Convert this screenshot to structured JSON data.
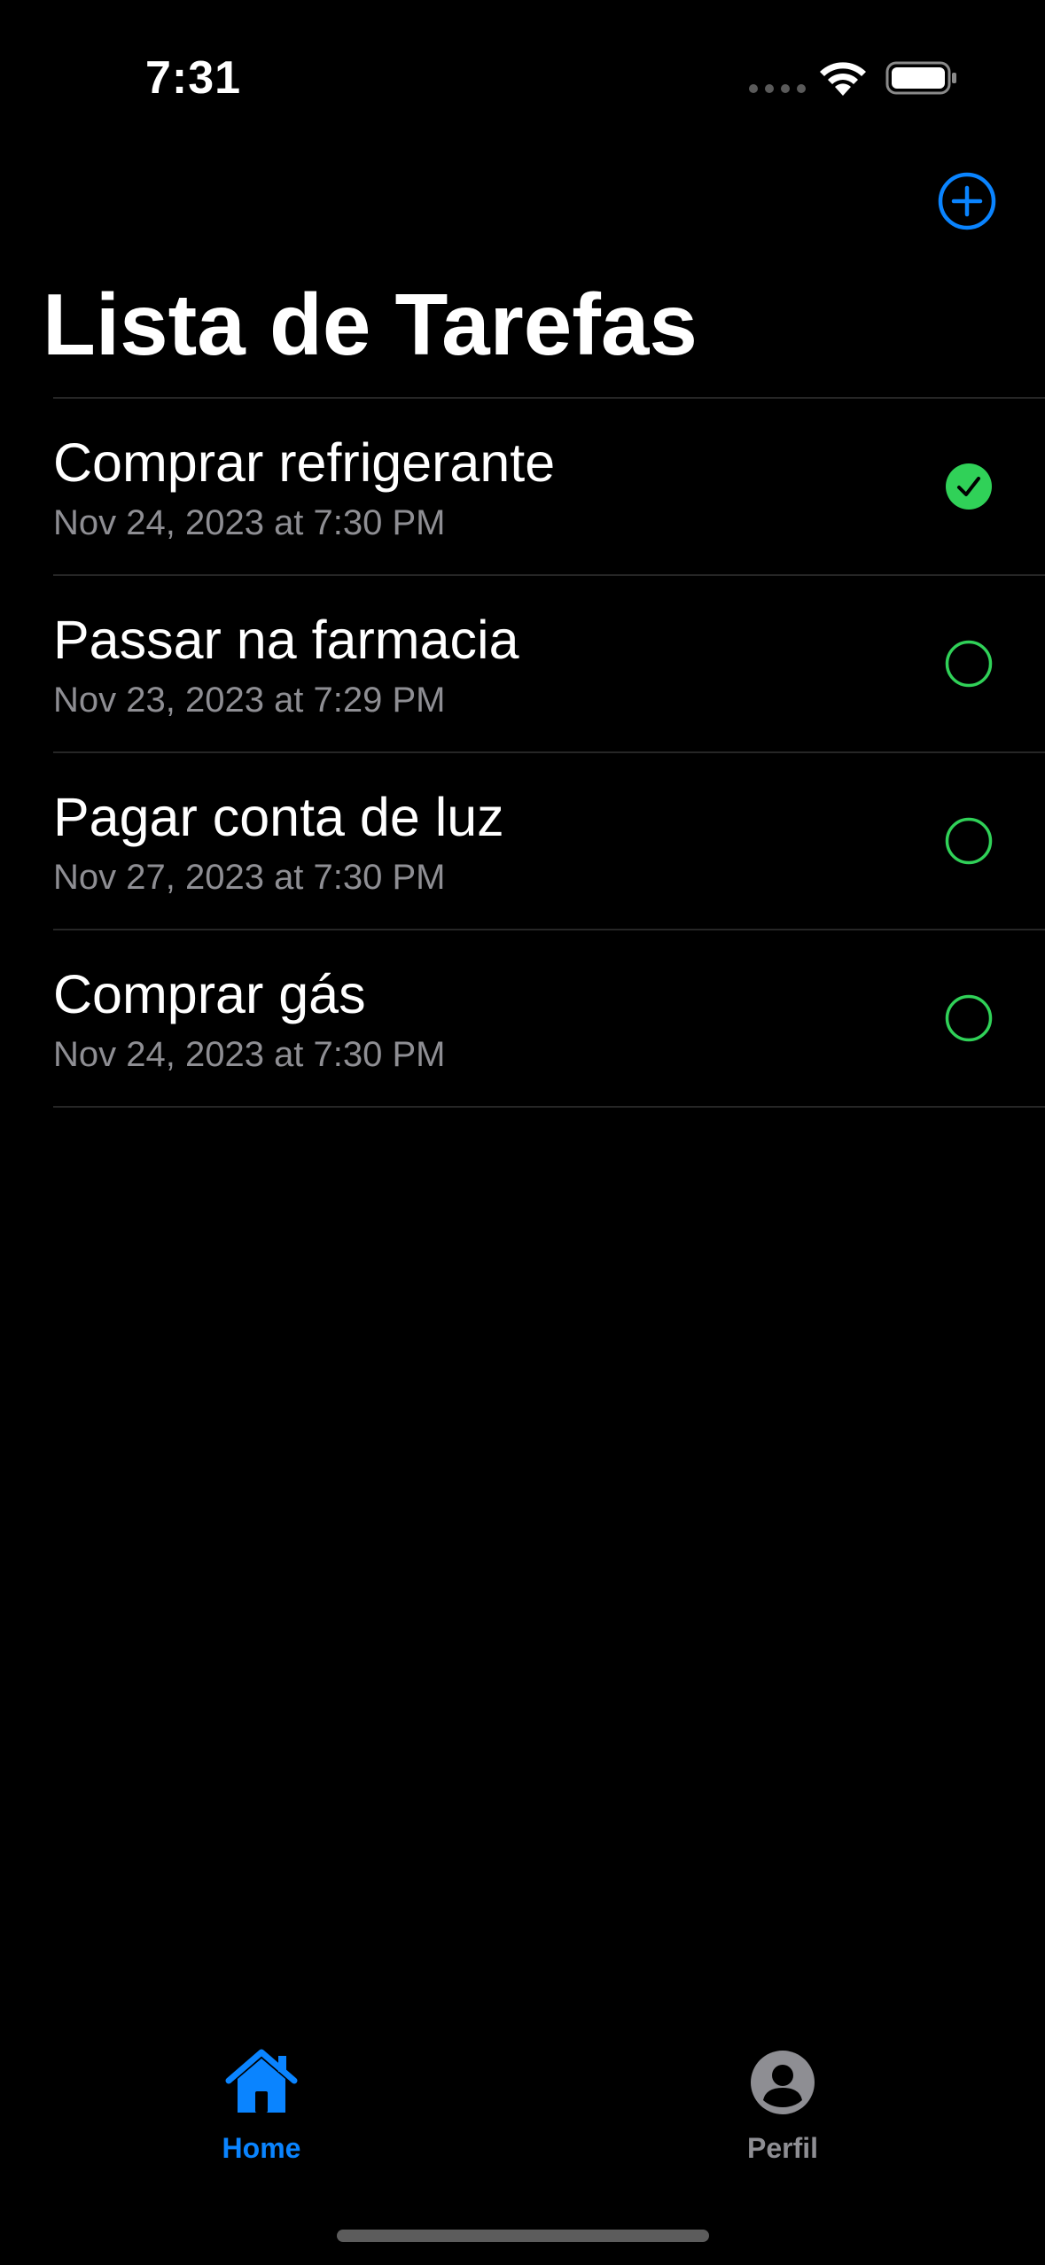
{
  "status_bar": {
    "time": "7:31"
  },
  "header": {
    "title": "Lista de Tarefas",
    "add_icon": "plus-circle-icon"
  },
  "tasks": [
    {
      "title": "Comprar refrigerante",
      "date": "Nov 24, 2023 at 7:30 PM",
      "completed": true
    },
    {
      "title": "Passar na farmacia",
      "date": "Nov 23, 2023 at 7:29 PM",
      "completed": false
    },
    {
      "title": "Pagar conta de luz",
      "date": "Nov 27, 2023 at 7:30 PM",
      "completed": false
    },
    {
      "title": "Comprar gás",
      "date": "Nov 24, 2023 at 7:30 PM",
      "completed": false
    }
  ],
  "tab_bar": {
    "tabs": [
      {
        "label": "Home",
        "icon": "house-icon",
        "active": true
      },
      {
        "label": "Perfil",
        "icon": "person-circle-icon",
        "active": false
      }
    ]
  },
  "colors": {
    "background": "#000000",
    "accent": "#0A84FF",
    "success": "#30D158",
    "secondary_text": "#8E8E93",
    "inactive_tab": "#8E8E93",
    "separator": "#262626"
  }
}
